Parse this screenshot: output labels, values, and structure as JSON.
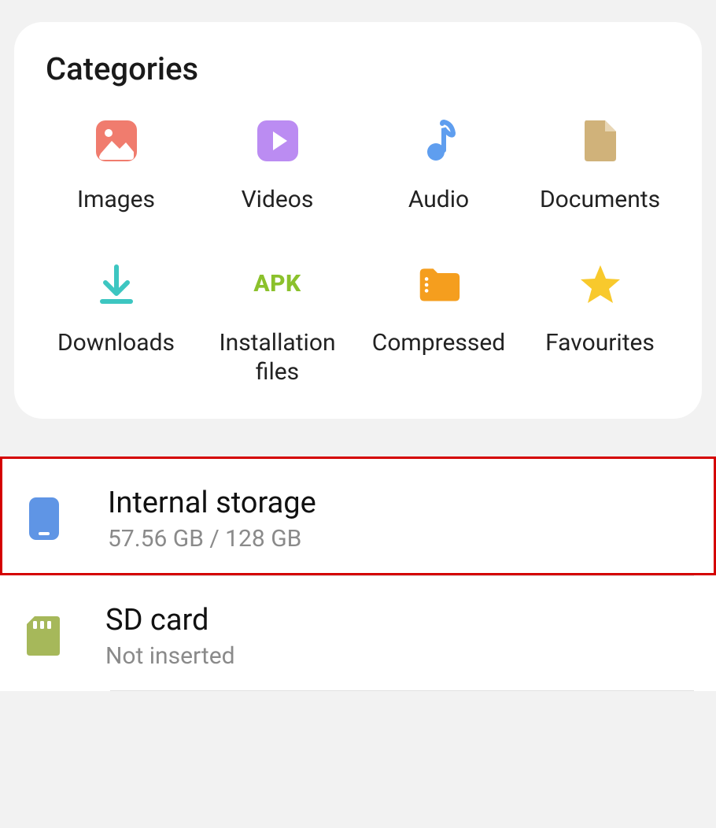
{
  "categories": {
    "title": "Categories",
    "items": [
      {
        "label": "Images"
      },
      {
        "label": "Videos"
      },
      {
        "label": "Audio"
      },
      {
        "label": "Documents"
      },
      {
        "label": "Downloads"
      },
      {
        "label": "Installation files",
        "apk": "APK"
      },
      {
        "label": "Compressed"
      },
      {
        "label": "Favourites"
      }
    ]
  },
  "storage": {
    "internal": {
      "title": "Internal storage",
      "sub": "57.56 GB / 128 GB"
    },
    "sdcard": {
      "title": "SD card",
      "sub": "Not inserted"
    }
  }
}
